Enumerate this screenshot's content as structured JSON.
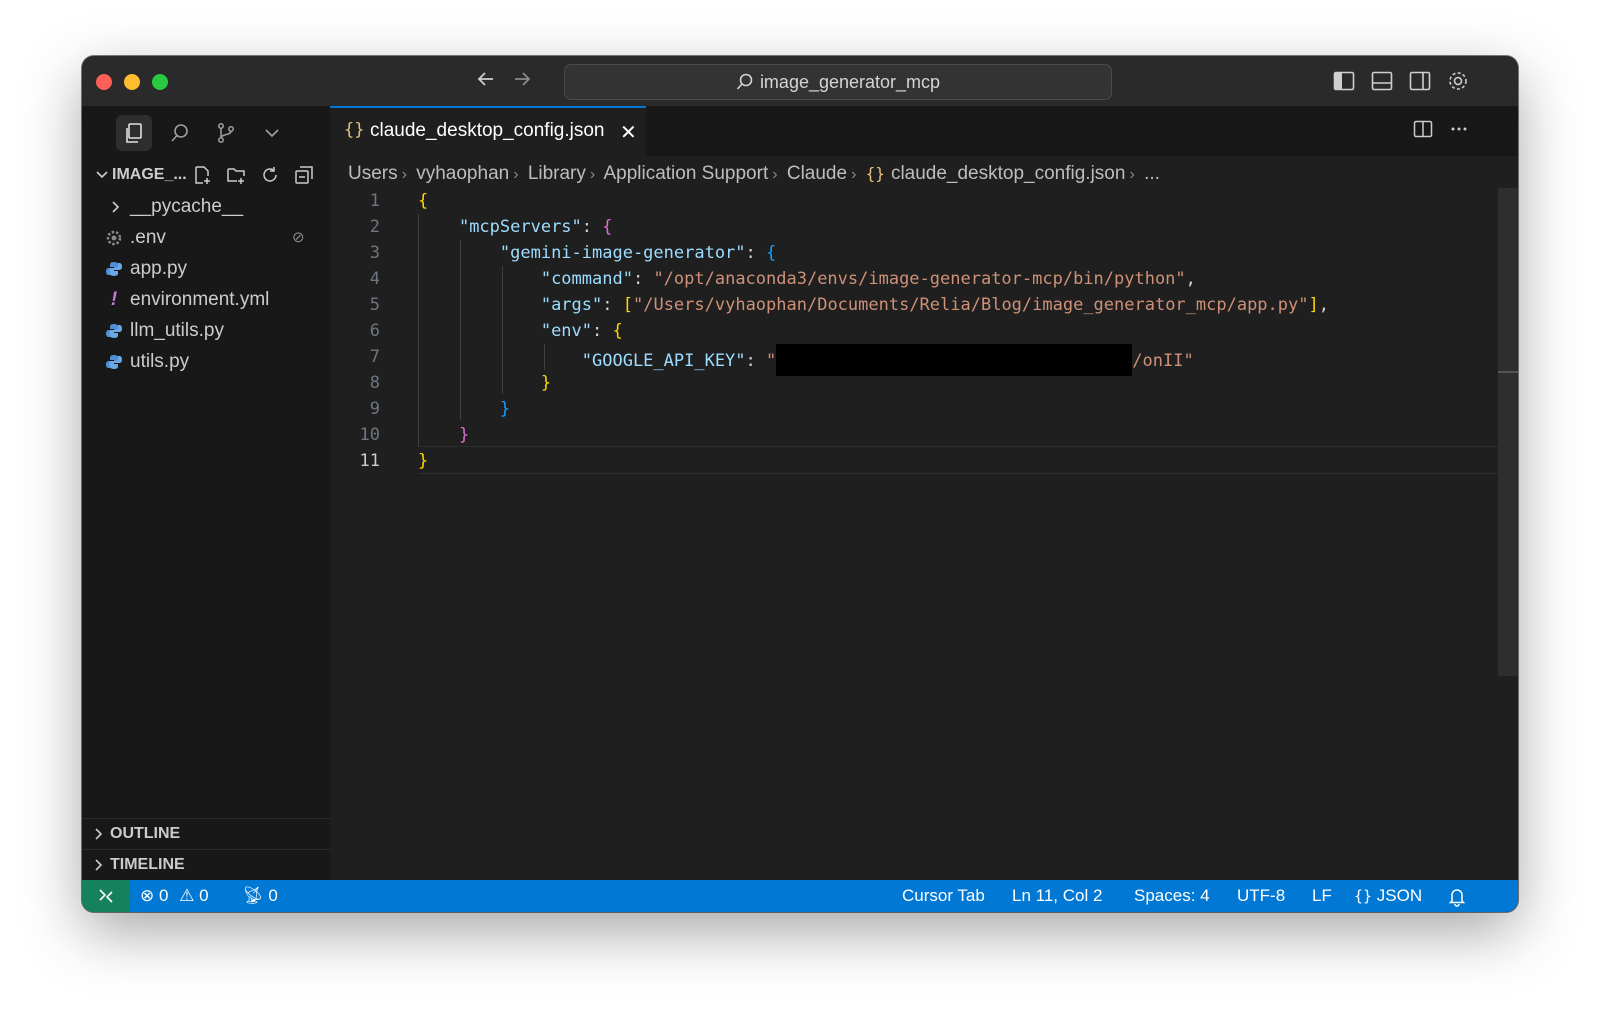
{
  "titlebar": {
    "search_text": "image_generator_mcp",
    "back_icon": "arrow-left-icon",
    "forward_icon": "arrow-right-icon"
  },
  "sidebar": {
    "explorer_title": "IMAGE_...",
    "files": [
      {
        "label": "__pycache__",
        "icon": "chevron-right-icon"
      },
      {
        "label": ".env",
        "icon": "gear-icon"
      },
      {
        "label": "app.py",
        "icon": "python-icon"
      },
      {
        "label": "environment.yml",
        "icon": "exclamation-icon"
      },
      {
        "label": "llm_utils.py",
        "icon": "python-icon"
      },
      {
        "label": "utils.py",
        "icon": "python-icon"
      }
    ],
    "outline_label": "OUTLINE",
    "timeline_label": "TIMELINE"
  },
  "tab": {
    "icon_text": "{}",
    "name": "claude_desktop_config.json",
    "close": "✕"
  },
  "breadcrumb": {
    "items": [
      "Users",
      "vyhaophan",
      "Library",
      "Application Support",
      "Claude"
    ],
    "file_icon": "{}",
    "file": "claude_desktop_config.json",
    "more": "..."
  },
  "code": {
    "line_numbers": [
      "1",
      "2",
      "3",
      "4",
      "5",
      "6",
      "7",
      "8",
      "9",
      "10",
      "11"
    ],
    "key_mcp": "\"mcpServers\"",
    "key_server": "\"gemini-image-generator\"",
    "key_command": "\"command\"",
    "val_command": "\"/opt/anaconda3/envs/image-generator-mcp/bin/python\"",
    "key_args": "\"args\"",
    "val_args": "\"/Users/vyhaophan/Documents/Relia/Blog/image_generator_mcp/app.py\"",
    "key_env": "\"env\"",
    "key_api": "\"GOOGLE_API_KEY\"",
    "val_api_start": "\"",
    "val_api_end": "/onII\""
  },
  "statusbar": {
    "errors": "0",
    "warnings": "0",
    "ports": "0",
    "cursor_tab": "Cursor Tab",
    "position": "Ln 11, Col 2",
    "spaces": "Spaces: 4",
    "encoding": "UTF-8",
    "eol": "LF",
    "lang_icon": "{}",
    "language": "JSON"
  },
  "colors": {
    "accent": "#0078d4",
    "remote": "#16825d",
    "editor_bg": "#1f1f1f",
    "sidebar_bg": "#181818"
  }
}
